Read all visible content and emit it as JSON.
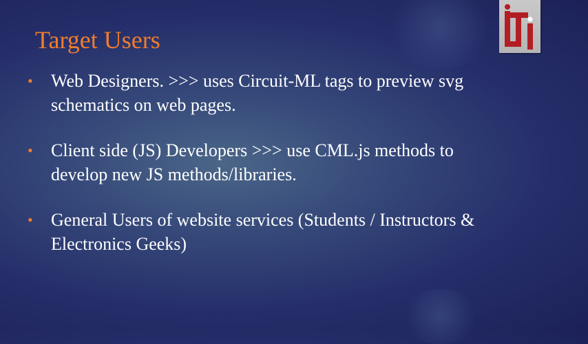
{
  "slide": {
    "title": "Target Users",
    "logo_text": "iti",
    "bullet_marker": "•",
    "bullets": [
      {
        "text": "Web Designers. >>> uses Circuit-ML tags to preview svg schematics on web pages."
      },
      {
        "text": "Client side (JS) Developers >>> use CML.js methods to develop new JS methods/libraries."
      },
      {
        "text": "General Users of website services (Students / Instructors & Electronics Geeks)"
      }
    ]
  },
  "colors": {
    "title": "#f07d2c",
    "bullet_marker": "#f07d2c",
    "body_text": "#ffffff",
    "background_dark": "#1c2158",
    "background_light": "#4b6688",
    "logo_red": "#b31e24",
    "logo_bg": "#c2c2c2"
  }
}
